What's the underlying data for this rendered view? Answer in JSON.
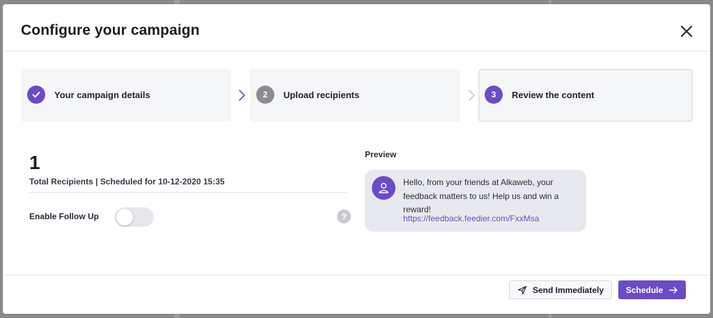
{
  "modal": {
    "title": "Configure your campaign"
  },
  "steps": [
    {
      "label": "Your campaign details",
      "number": "",
      "state": "done"
    },
    {
      "label": "Upload recipients",
      "number": "2",
      "state": "pending"
    },
    {
      "label": "Review the content",
      "number": "3",
      "state": "active"
    }
  ],
  "summary": {
    "count": "1",
    "subtitle": "Total Recipients | Scheduled for 10-12-2020 15:35"
  },
  "follow_up": {
    "label": "Enable Follow Up",
    "enabled": false,
    "help_glyph": "?"
  },
  "preview": {
    "label": "Preview",
    "message": "Hello, from your friends at Alkaweb, your feedback matters to us! Help us and win a reward!",
    "link": "https://feedback.feedier.com/FxxMsa"
  },
  "footer": {
    "send_label": "Send Immediately",
    "schedule_label": "Schedule"
  },
  "colors": {
    "accent": "#6a4cc4",
    "step_done": "#6a4cc4",
    "step_pending": "#8c8d94",
    "step_active": "#6a4cc4"
  },
  "icons": {
    "close": "close-icon",
    "check": "check-icon",
    "chevron": "chevron-right-icon",
    "help": "question-icon",
    "avatar": "user-icon",
    "send": "paper-plane-icon",
    "schedule": "arrow-right-icon"
  }
}
